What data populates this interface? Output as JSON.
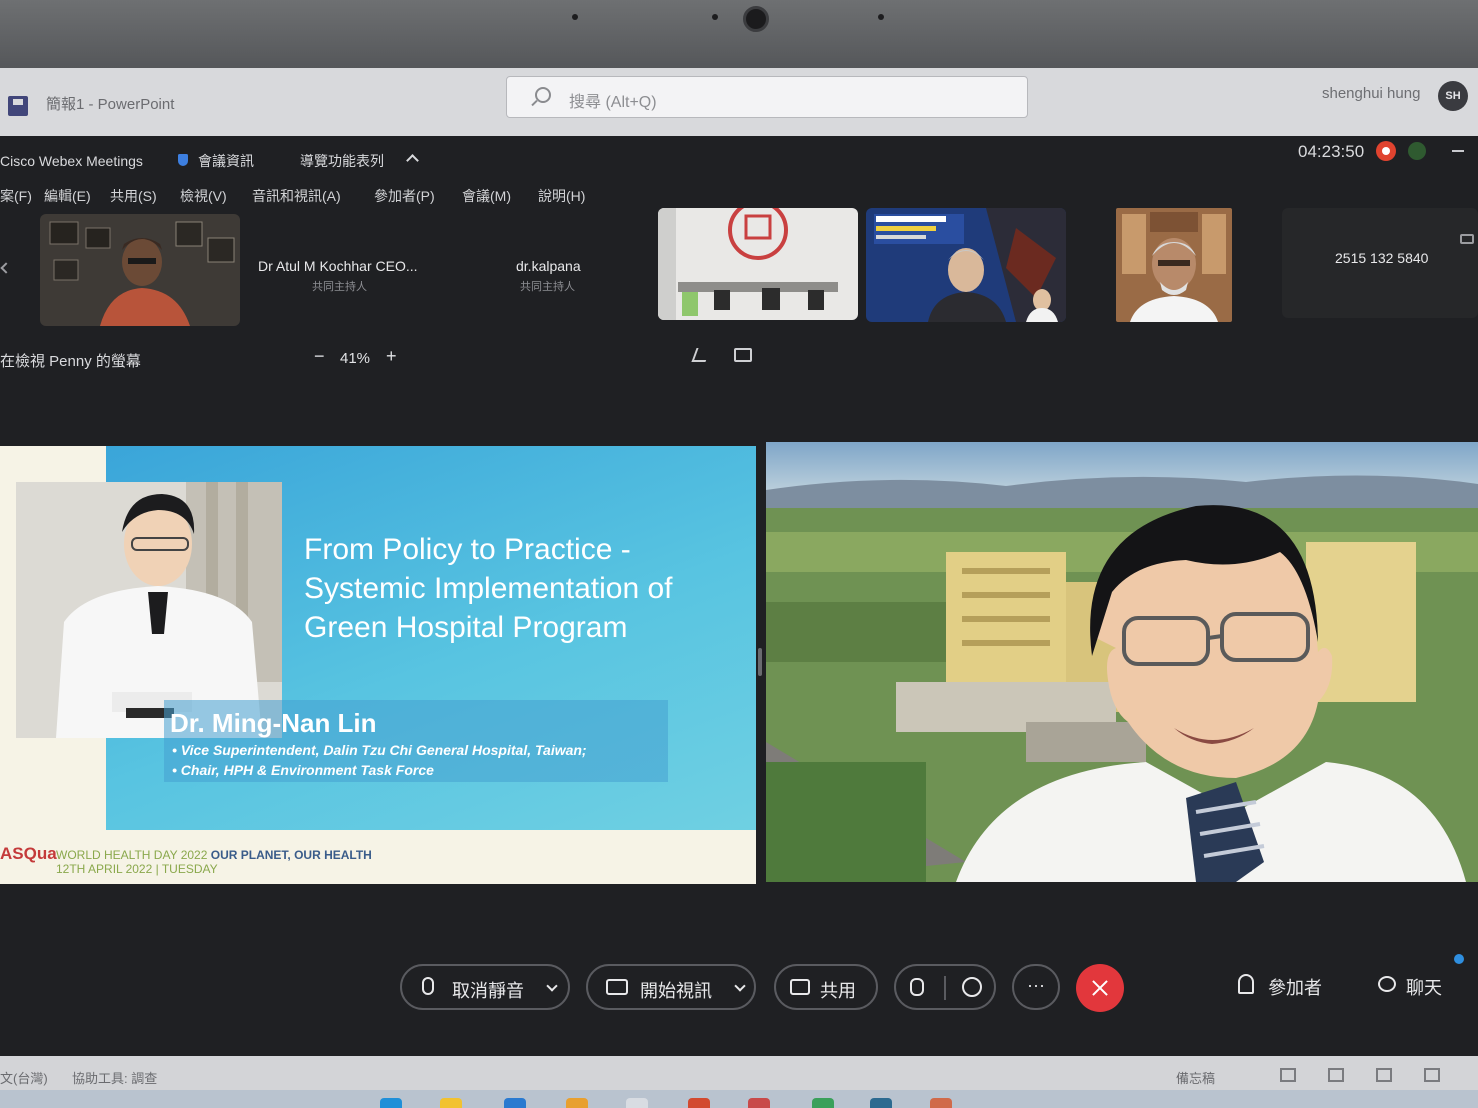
{
  "ppt": {
    "doc_title": "簡報1  -  PowerPoint",
    "search_placeholder": "搜尋 (Alt+Q)",
    "user_name": "shenghui hung",
    "user_initials": "SH"
  },
  "webex": {
    "app_name": "Cisco Webex Meetings",
    "meeting_info": "會議資訊",
    "nav_toggle": "導覽功能表列",
    "timer": "04:23:50",
    "menu": [
      {
        "label": "案(F)"
      },
      {
        "label": "編輯(E)"
      },
      {
        "label": "共用(S)"
      },
      {
        "label": "檢視(V)"
      },
      {
        "label": "音訊和視訊(A)"
      },
      {
        "label": "參加者(P)"
      },
      {
        "label": "會議(M)"
      },
      {
        "label": "說明(H)"
      }
    ],
    "participants": [
      {
        "name": "Dr Atul M Kochhar CEO...",
        "role": "共同主持人"
      },
      {
        "name": "dr.kalpana",
        "role": "共同主持人"
      }
    ],
    "meeting_number": "2515 132 5840",
    "viewing_label": "在檢視 Penny 的螢幕",
    "zoom": {
      "minus": "−",
      "value": "41%",
      "plus": "+"
    }
  },
  "slide": {
    "title_lines": [
      "From Policy to Practice -",
      "Systemic Implementation of",
      "Green Hospital Program"
    ],
    "speaker_name": "Dr. Ming-Nan Lin",
    "speaker_lines": [
      "• Vice Superintendent, Dalin Tzu Chi General Hospital, Taiwan;",
      "• Chair, HPH & Environment Task Force"
    ],
    "logo_text": "ASQua",
    "event_line1": "WORLD HEALTH DAY 2022",
    "event_line1_bold": "OUR PLANET, OUR HEALTH",
    "event_line2": "12TH APRIL 2022 | TUESDAY"
  },
  "controls": {
    "unmute": "取消靜音",
    "start_video": "開始視訊",
    "share": "共用",
    "more": "···",
    "participants": "參加者",
    "chat": "聊天"
  },
  "statusbar": {
    "language": "文(台灣)",
    "accessibility": "協助工具: 調查",
    "notes": "備忘稿"
  },
  "colors": {
    "leave_red": "#e2373c",
    "slide_blue": "#3aa5d9",
    "record_red": "#e0432f"
  }
}
